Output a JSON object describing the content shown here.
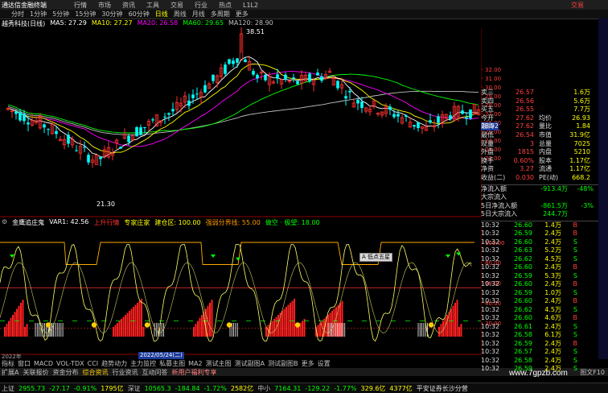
{
  "app": {
    "title": "通达信金融终端",
    "menu": [
      "行情",
      "市场",
      "资讯",
      "工具",
      "交易",
      "行业",
      "热点",
      "L1L2"
    ],
    "trade_label": "交易"
  },
  "periods": [
    "分时",
    "1分钟",
    "5分钟",
    "15分钟",
    "30分钟",
    "60分钟",
    "日线",
    "周线",
    "月线",
    "多周期",
    "更多"
  ],
  "ma_legend": {
    "stock": "越秀科技(日线)",
    "ma5": "MA5: 27.29",
    "ma10": "MA10: 27.27",
    "ma20": "MA20: 26.58",
    "ma60": "MA60: 29.65",
    "ma120": "MA120: 28.90"
  },
  "price_labels": {
    "high": "38.51",
    "low": "21.30",
    "current": "28.92"
  },
  "axis_price": [
    "32.00",
    "31.00",
    "30.00",
    "29.00",
    "28.00",
    "27.00",
    "26.00",
    "25.00",
    "24.00",
    "23.00",
    "22.00"
  ],
  "ind_legend": {
    "name": "金鹰追庄鬼",
    "var1": "VAR1: 42.56",
    "up": "上升行情",
    "mid": "专家庄家",
    "level": "建仓区: 100.00",
    "extra": "强弱分界线: 55.00",
    "cont": "做空 · 极望: 18.00"
  },
  "axis_ind": [
    "100.00",
    "80.00",
    "60.00",
    "40.00",
    "20.00"
  ],
  "tooltip": "A 低点五星",
  "date_label": "2022/05/24(二)",
  "year_label": "2022年",
  "bottom_tabs": [
    "指标",
    "窗口",
    "MACD",
    "VOL-TDX",
    "CCI",
    "趋势动力",
    "主力监控",
    "私募主图",
    "MA2",
    "测试主图",
    "测试副图A",
    "测试副图B",
    "更多",
    "设置"
  ],
  "func_bar": [
    "扩展A",
    "关联报价",
    "资金分布",
    "综合资讯",
    "行业资讯",
    "互动问答",
    "新用户福利专享"
  ],
  "quote": {
    "rows": [
      {
        "l": "卖三",
        "v": "26.57",
        "v2": "1.6万"
      },
      {
        "l": "卖四",
        "v": "26.56",
        "v2": "5.6万"
      },
      {
        "l": "买五",
        "v": "26.55",
        "v2": "7.7万"
      },
      {
        "l": "今开",
        "v": "27.62",
        "l2": "均价",
        "v2": "26.93"
      },
      {
        "l": "最高",
        "v": "27.62",
        "l2": "量比",
        "v2": "1.84"
      },
      {
        "l": "最低",
        "v": "26.54",
        "l2": "市值",
        "v2": "31.9亿"
      },
      {
        "l": "现量",
        "v": "3",
        "l2": "总量",
        "v2": "7025"
      },
      {
        "l": "外盘",
        "v": "1815",
        "l2": "内盘",
        "v2": "5210"
      },
      {
        "l": "换手",
        "v": "0.60%",
        "l2": "股本",
        "v2": "1.17亿"
      },
      {
        "l": "净资",
        "v": "3.27",
        "l2": "流通",
        "v2": "1.17亿"
      },
      {
        "l": "收益(二)",
        "v": "0.030",
        "l2": "PE(动)",
        "v2": "668.2"
      }
    ],
    "flow": [
      {
        "l": "净流入额",
        "v": "-913.4万",
        "v2": "-48%"
      },
      {
        "l": "大宗流入",
        "v": "",
        "v2": ""
      },
      {
        "l": "5日净流入额",
        "v": "-861.5万",
        "v2": "-3%"
      },
      {
        "l": "5日大宗流入",
        "v": "244.7万",
        "v2": ""
      }
    ]
  },
  "ticks": [
    {
      "t": "10:32",
      "p": "26.59",
      "v": "2.4万",
      "s": "B"
    },
    {
      "t": "10:32",
      "p": "26.60",
      "v": "2.4万",
      "s": "S"
    },
    {
      "t": "10:32",
      "p": "26.63",
      "v": "5.2万",
      "s": "S"
    },
    {
      "t": "10:32",
      "p": "26.62",
      "v": "4.5万",
      "s": "S"
    },
    {
      "t": "10:32",
      "p": "26.60",
      "v": "2.4万",
      "s": "B"
    },
    {
      "t": "10:32",
      "p": "26.59",
      "v": "5.3万",
      "s": "S"
    },
    {
      "t": "10:32",
      "p": "26.60",
      "v": "2.4万",
      "s": "B"
    },
    {
      "t": "10:32",
      "p": "26.59",
      "v": "1.0万",
      "s": "S"
    },
    {
      "t": "10:32",
      "p": "26.60",
      "v": "2.4万",
      "s": "B"
    },
    {
      "t": "10:32",
      "p": "26.62",
      "v": "4.5万",
      "s": "S"
    },
    {
      "t": "10:32",
      "p": "26.60",
      "v": "4.6万",
      "s": "B"
    },
    {
      "t": "10:32",
      "p": "26.61",
      "v": "2.4万",
      "s": "S"
    },
    {
      "t": "10:32",
      "p": "26.58",
      "v": "6.1万",
      "s": "S"
    },
    {
      "t": "10:32",
      "p": "26.59",
      "v": "2.4万",
      "s": "B"
    },
    {
      "t": "10:32",
      "p": "26.57",
      "v": "2.4万",
      "s": "S"
    },
    {
      "t": "10:32",
      "p": "26.58",
      "v": "2.4万",
      "s": "S"
    },
    {
      "t": "10:32",
      "p": "26.59",
      "v": "2.4万",
      "s": "S"
    }
  ],
  "ticks_top": {
    "t": "10:32",
    "p": "26.60",
    "v": "1.4万",
    "s": "B"
  },
  "status": [
    {
      "name": "上证",
      "val": "2955.73",
      "chg": "-27.17",
      "pct": "-0.91%",
      "amt": "1795亿"
    },
    {
      "name": "深证",
      "val": "10565.3",
      "chg": "-184.84",
      "pct": "-1.72%",
      "amt": "2582亿"
    },
    {
      "name": "中小",
      "val": "7164.31",
      "chg": "-129.22",
      "pct": "-1.77%",
      "amt": "329.6亿"
    },
    {
      "name": "创业",
      "val": "",
      "chg": "",
      "pct": "",
      "amt": "4377亿"
    }
  ],
  "status_extra": "平安证券长沙分营",
  "watermark": "www.7gpzb.com",
  "corner": "图文F10",
  "colors": {
    "up": "#ff3030",
    "down": "#00ffff",
    "ma5": "#ffffff",
    "ma10": "#ffff00",
    "ma20": "#ff00ff",
    "ma60": "#00ff00",
    "ma120": "#c0c0c0"
  }
}
